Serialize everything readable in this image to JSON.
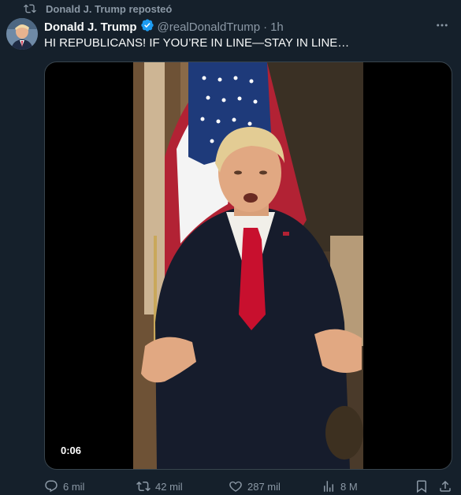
{
  "repost": {
    "label": "Donald J. Trump reposteó",
    "icon": "repost-icon"
  },
  "tweet": {
    "author": {
      "display_name": "Donald J. Trump",
      "handle": "@realDonaldTrump",
      "verified": true,
      "verified_color": "#1d9bf0"
    },
    "separator": "·",
    "time": "1h",
    "text": "HI REPUBLICANS! IF YOU’RE IN LINE—STAY IN LINE…",
    "media": {
      "type": "video",
      "duration": "0:06"
    },
    "actions": {
      "replies": "6 mil",
      "reposts": "42 mil",
      "likes": "287 mil",
      "views": "8 M"
    }
  },
  "colors": {
    "background": "#15202b",
    "text": "#f7f9f9",
    "secondary": "#8b98a5",
    "border": "#38444d"
  }
}
